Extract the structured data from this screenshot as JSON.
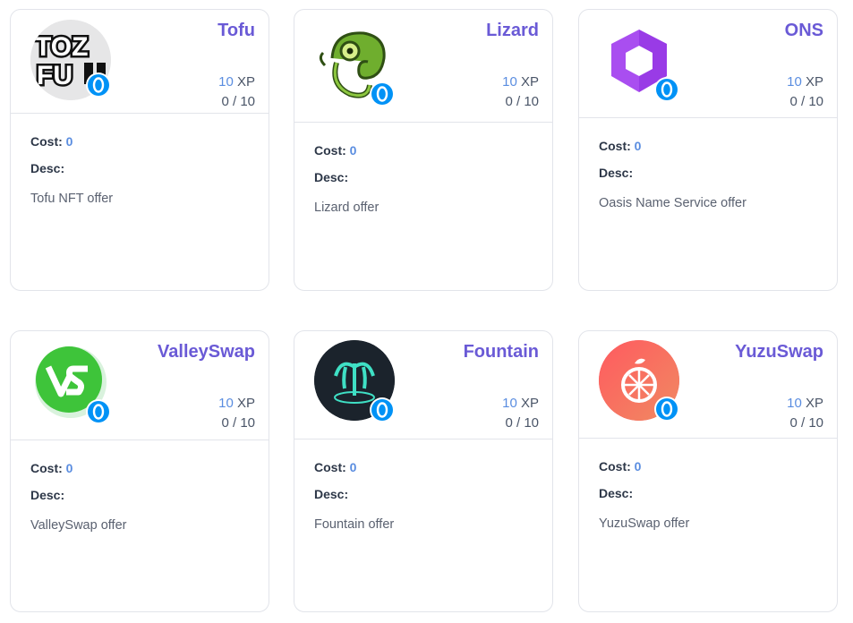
{
  "colors": {
    "title": "#6a5ad6",
    "accent": "#5a8de0",
    "border": "#e2e4ea"
  },
  "labels": {
    "cost": "Cost:",
    "desc": "Desc:",
    "xp_unit": "XP"
  },
  "cards": [
    {
      "name": "Tofu",
      "xp": "10",
      "progress": "0 / 10",
      "cost": "0",
      "desc": "Tofu NFT offer",
      "logo_icon": "tofu-logo-icon"
    },
    {
      "name": "Lizard",
      "xp": "10",
      "progress": "0 / 10",
      "cost": "0",
      "desc": "Lizard offer",
      "logo_icon": "chameleon-logo-icon"
    },
    {
      "name": "ONS",
      "xp": "10",
      "progress": "0 / 10",
      "cost": "0",
      "desc": "Oasis Name Service offer",
      "logo_icon": "hexagon-logo-icon"
    },
    {
      "name": "ValleySwap",
      "xp": "10",
      "progress": "0 / 10",
      "cost": "0",
      "desc": "ValleySwap offer",
      "logo_icon": "valleyswap-logo-icon"
    },
    {
      "name": "Fountain",
      "xp": "10",
      "progress": "0 / 10",
      "cost": "0",
      "desc": "Fountain offer",
      "logo_icon": "fountain-logo-icon"
    },
    {
      "name": "YuzuSwap",
      "xp": "10",
      "progress": "0 / 10",
      "cost": "0",
      "desc": "YuzuSwap offer",
      "logo_icon": "yuzu-logo-icon"
    }
  ]
}
